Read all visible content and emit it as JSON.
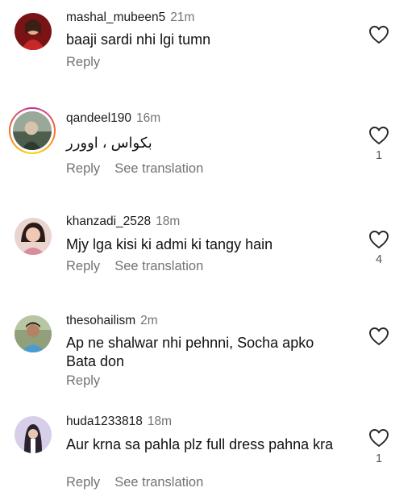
{
  "comments": [
    {
      "username": "mashal_mubeen5",
      "time": "21m",
      "text": "baaji sardi nhi lgi tumn",
      "reply_label": "Reply",
      "translate_label": "",
      "like_count": ""
    },
    {
      "username": "qandeel190",
      "time": "16m",
      "text": "بکواس ، اوورر",
      "reply_label": "Reply",
      "translate_label": "See translation",
      "like_count": "1"
    },
    {
      "username": "khanzadi_2528",
      "time": "18m",
      "text": "Mjy lga kisi ki admi ki tangy hain",
      "reply_label": "Reply",
      "translate_label": "See translation",
      "like_count": "4"
    },
    {
      "username": "thesohailism",
      "time": "2m",
      "text": "Ap ne shalwar nhi pehnni, Socha apko Bata don",
      "reply_label": "Reply",
      "translate_label": "",
      "like_count": ""
    },
    {
      "username": "huda1233818",
      "time": "18m",
      "text": "Aur  krna sa pahla plz full dress pahna kra",
      "reply_label": "Reply",
      "translate_label": "See translation",
      "like_count": "1"
    }
  ],
  "icons": {
    "like": "heart-outline-icon",
    "story_ring": "story-ring"
  },
  "colors": {
    "secondary_text": "#737373",
    "story_ring_start": "#c32aa3",
    "story_ring_end": "#ffd600"
  }
}
